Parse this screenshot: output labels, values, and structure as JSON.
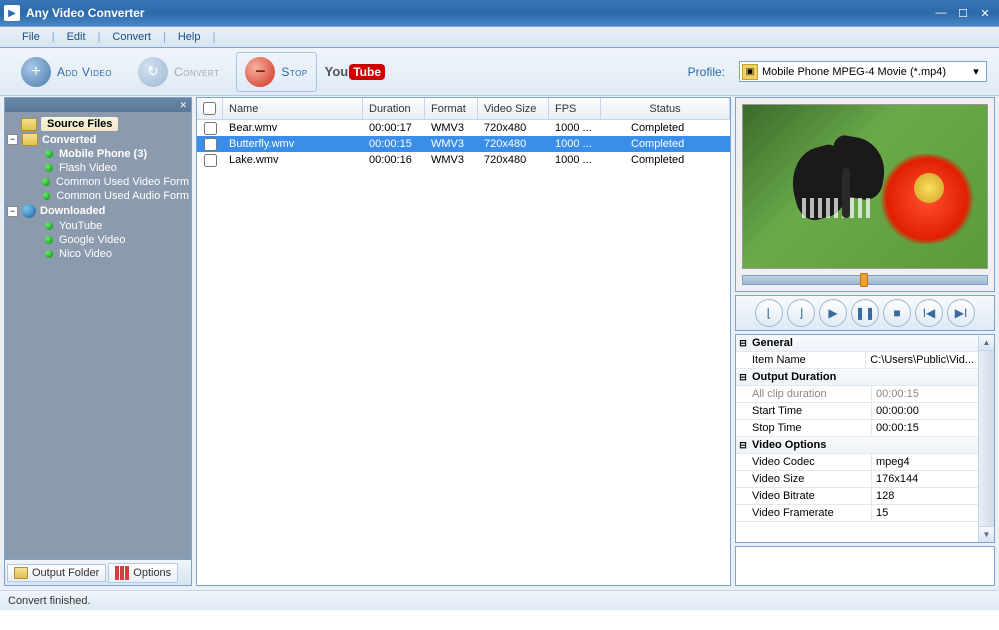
{
  "app": {
    "title": "Any Video Converter"
  },
  "menu": {
    "file": "File",
    "edit": "Edit",
    "convert": "Convert",
    "help": "Help"
  },
  "toolbar": {
    "add_video": "Add Video",
    "convert": "Convert",
    "stop": "Stop",
    "profile_label": "Profile:",
    "profile_selected": "Mobile Phone MPEG-4 Movie (*.mp4)"
  },
  "tree": {
    "source_files": "Source Files",
    "converted": "Converted",
    "mobile_phone": "Mobile Phone (3)",
    "flash_video": "Flash Video",
    "common_video": "Common Used Video Form",
    "common_audio": "Common Used Audio Form",
    "downloaded": "Downloaded",
    "youtube": "YouTube",
    "google_video": "Google Video",
    "nico_video": "Nico Video"
  },
  "sidebar_buttons": {
    "output_folder": "Output Folder",
    "options": "Options"
  },
  "grid": {
    "headers": {
      "name": "Name",
      "duration": "Duration",
      "format": "Format",
      "video_size": "Video Size",
      "fps": "FPS",
      "status": "Status"
    },
    "rows": [
      {
        "name": "Bear.wmv",
        "duration": "00:00:17",
        "format": "WMV3",
        "video_size": "720x480",
        "fps": "1000 ...",
        "status": "Completed",
        "selected": false
      },
      {
        "name": "Butterfly.wmv",
        "duration": "00:00:15",
        "format": "WMV3",
        "video_size": "720x480",
        "fps": "1000 ...",
        "status": "Completed",
        "selected": true
      },
      {
        "name": "Lake.wmv",
        "duration": "00:00:16",
        "format": "WMV3",
        "video_size": "720x480",
        "fps": "1000 ...",
        "status": "Completed",
        "selected": false
      }
    ]
  },
  "properties": {
    "sections": [
      {
        "title": "General",
        "rows": [
          {
            "key": "Item Name",
            "val": "C:\\Users\\Public\\Vid...",
            "dim": false
          }
        ]
      },
      {
        "title": "Output Duration",
        "rows": [
          {
            "key": "All clip duration",
            "val": "00:00:15",
            "dim": true
          },
          {
            "key": "Start Time",
            "val": "00:00:00",
            "dim": false
          },
          {
            "key": "Stop Time",
            "val": "00:00:15",
            "dim": false
          }
        ]
      },
      {
        "title": "Video Options",
        "rows": [
          {
            "key": "Video Codec",
            "val": "mpeg4",
            "dim": false
          },
          {
            "key": "Video Size",
            "val": "176x144",
            "dim": false
          },
          {
            "key": "Video Bitrate",
            "val": "128",
            "dim": false
          },
          {
            "key": "Video Framerate",
            "val": "15",
            "dim": false
          }
        ]
      }
    ]
  },
  "status": "Convert finished."
}
